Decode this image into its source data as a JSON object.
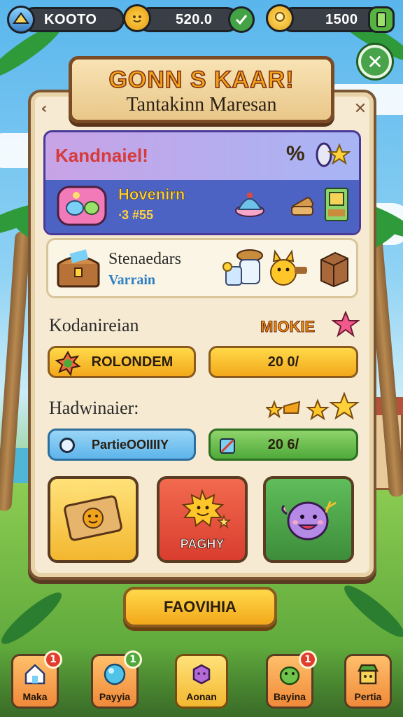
{
  "top_bar": {
    "player_name": "KOOTO",
    "coins": "520.0",
    "gems": "1500"
  },
  "banner": {
    "title": "GONN S KAAR!",
    "subtitle": "Tantakinn Maresan"
  },
  "featured_card": {
    "title": "Kandnaiel!",
    "badge_text": "%",
    "item_name": "Hovenirn",
    "item_price": "∙3 #55"
  },
  "second_card": {
    "title": "Stenaedars",
    "subtitle": "Varrain"
  },
  "section1": {
    "label": "Kodanireian",
    "tag": "MIOKIE",
    "button_label": "ROLONDEM",
    "progress_text": "20 0/"
  },
  "section2": {
    "label": "Hadwinaier:",
    "option_label": "PartieOOIIIIY",
    "progress_text": "20 6/"
  },
  "tiles": {
    "middle_label": "PAGHY"
  },
  "main_button": {
    "label": "FAOVIHIA"
  },
  "bottom_nav": [
    {
      "label": "Maka",
      "badge": "1",
      "icon": "house-icon"
    },
    {
      "label": "Payyia",
      "badge": "1",
      "icon": "orb-icon"
    },
    {
      "label": "Aonan",
      "badge": "",
      "icon": "gem-icon"
    },
    {
      "label": "Bayina",
      "badge": "1",
      "icon": "creature-icon"
    },
    {
      "label": "Pertia",
      "badge": "",
      "icon": "shop-icon"
    }
  ],
  "colors": {
    "panel": "#f6ebd2",
    "accent_yellow": "#f2a81a",
    "accent_green": "#4fa93a",
    "accent_blue": "#5db4ea",
    "badge_red": "#e23c2c"
  }
}
